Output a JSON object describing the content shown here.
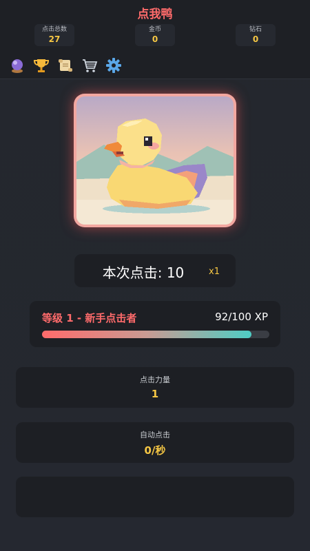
{
  "header": {
    "title": "点我鸭",
    "stats": [
      {
        "label": "点击总数",
        "value": "27"
      },
      {
        "label": "金币",
        "value": "0"
      },
      {
        "label": "钻石",
        "value": "0"
      }
    ],
    "toolbar": [
      "crystal-ball-icon",
      "trophy-icon",
      "scroll-icon",
      "cart-icon",
      "gear-icon"
    ]
  },
  "click_session": {
    "label": "本次点击: 10",
    "multiplier": "x1"
  },
  "level": {
    "name": "等级 1 - 新手点击者",
    "xp": "92/100 XP",
    "progress": 0.92
  },
  "upgrades": [
    {
      "label": "点击力量",
      "value": "1"
    },
    {
      "label": "自动点击",
      "value": "0/秒"
    },
    {
      "label": "",
      "value": ""
    }
  ],
  "colors": {
    "accent": "#ff6b6b",
    "gold": "#f6c744",
    "teal": "#4ecdc4",
    "background": "#23262c",
    "card": "#1d1f24"
  }
}
